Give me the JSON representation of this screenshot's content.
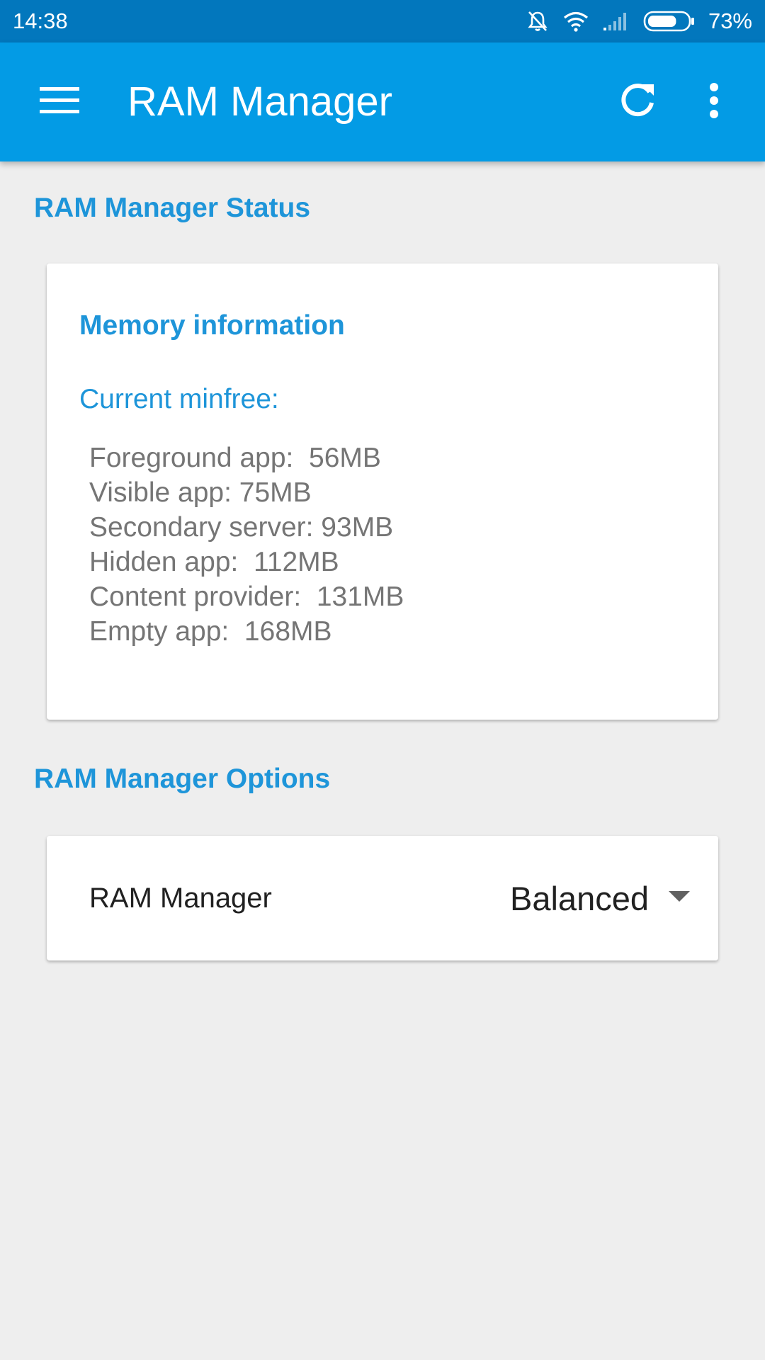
{
  "status_bar": {
    "time": "14:38",
    "battery_percent": "73%",
    "battery_level": 0.73,
    "icons": [
      "mute-icon",
      "wifi-icon",
      "signal-icon",
      "battery-icon"
    ]
  },
  "app_bar": {
    "title": "RAM Manager",
    "icons": [
      "menu-icon",
      "refresh-icon",
      "more-vert-icon"
    ]
  },
  "status_section": {
    "header": "RAM Manager Status",
    "card": {
      "title": "Memory information",
      "minfree_label": "Current minfree:",
      "items": [
        "Foreground app:  56MB",
        "Visible app: 75MB",
        "Secondary server: 93MB",
        "Hidden app:  112MB",
        "Content provider:  131MB",
        "Empty app:  168MB"
      ]
    }
  },
  "options_section": {
    "header": "RAM Manager Options",
    "option": {
      "label": "RAM Manager",
      "value": "Balanced"
    }
  },
  "colors": {
    "status_bar": "#0277bd",
    "app_bar": "#039be5",
    "accent_text": "#1e95d9",
    "background": "#eeeeee",
    "secondary_text": "#757575"
  }
}
